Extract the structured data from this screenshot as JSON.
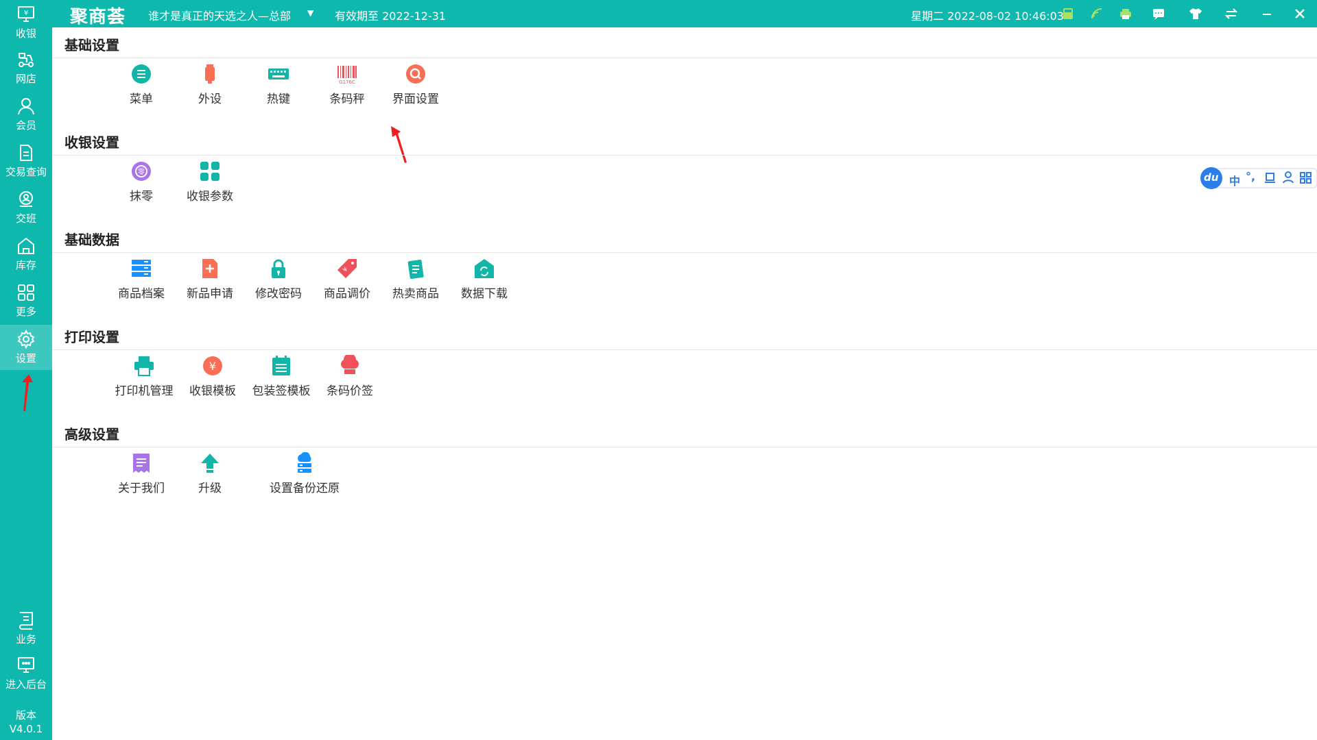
{
  "sidebar": {
    "items": [
      {
        "label": "收银",
        "icon": "cashier-icon"
      },
      {
        "label": "网店",
        "icon": "delivery-icon"
      },
      {
        "label": "会员",
        "icon": "member-icon"
      },
      {
        "label": "交易查询",
        "icon": "document-icon"
      },
      {
        "label": "交班",
        "icon": "shift-icon"
      },
      {
        "label": "库存",
        "icon": "warehouse-icon"
      },
      {
        "label": "更多",
        "icon": "grid-icon"
      },
      {
        "label": "设置",
        "icon": "gear-icon"
      },
      {
        "label": "业务",
        "icon": "book-icon"
      },
      {
        "label": "进入后台",
        "icon": "monitor-icon"
      }
    ],
    "active": "设置",
    "version_label": "版本",
    "version": "V4.0.1"
  },
  "topbar": {
    "logo": "聚商荟",
    "store": "谁才是真正的天选之人—总部",
    "expiry": "有效期至 2022-12-31",
    "datetime": "星期二 2022-08-02 10:46:03",
    "icons": [
      "calculator-icon",
      "wifi-icon",
      "printer-icon",
      "message-icon",
      "skin-icon",
      "swap-icon",
      "minimize-icon",
      "close-icon"
    ]
  },
  "sections": [
    {
      "title": "基础设置",
      "items": [
        "菜单",
        "外设",
        "热键",
        "条码秤",
        "界面设置"
      ]
    },
    {
      "title": "收银设置",
      "items": [
        "抹零",
        "收银参数"
      ]
    },
    {
      "title": "基础数据",
      "items": [
        "商品档案",
        "新品申请",
        "修改密码",
        "商品调价",
        "热卖商品",
        "数据下载"
      ]
    },
    {
      "title": "打印设置",
      "items": [
        "打印机管理",
        "收银模板",
        "包装签模板",
        "条码价签"
      ]
    },
    {
      "title": "高级设置",
      "items": [
        "关于我们",
        "升级",
        "设置备份还原"
      ]
    }
  ],
  "ime": {
    "logo": "du",
    "mode": "中",
    "punct": "°,"
  },
  "colors": {
    "primary": "#0fb8ad",
    "accent_red": "#f0505a",
    "blue": "#1890ff"
  }
}
